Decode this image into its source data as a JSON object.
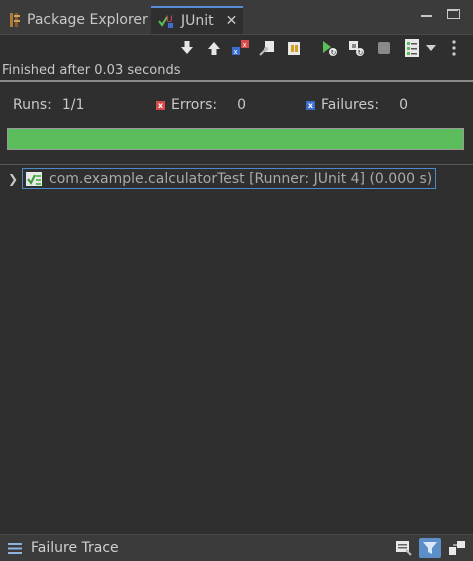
{
  "tabs": {
    "package_explorer": "Package Explorer",
    "junit": "JUnit"
  },
  "toolbar": {
    "icons": [
      "next-failure-icon",
      "previous-failure-icon",
      "show-failures-only-icon",
      "scroll-lock-icon",
      "show-skipped-icon",
      "rerun-icon",
      "rerun-failures-first-icon",
      "stop-icon",
      "test-run-history-icon",
      "dropdown-icon",
      "view-menu-icon"
    ]
  },
  "status": {
    "message": "Finished after 0.03 seconds"
  },
  "counters": {
    "runs_label": "Runs:",
    "runs_value": "1/1",
    "errors_label": "Errors:",
    "errors_value": "0",
    "failures_label": "Failures:",
    "failures_value": "0"
  },
  "progress": {
    "fraction": 1.0,
    "color": "#5bbd5b"
  },
  "tree": {
    "items": [
      {
        "label": "com.example.calculatorTest [Runner: JUnit 4] (0.000 s)"
      }
    ]
  },
  "failure_trace": {
    "title": "Failure Trace"
  }
}
